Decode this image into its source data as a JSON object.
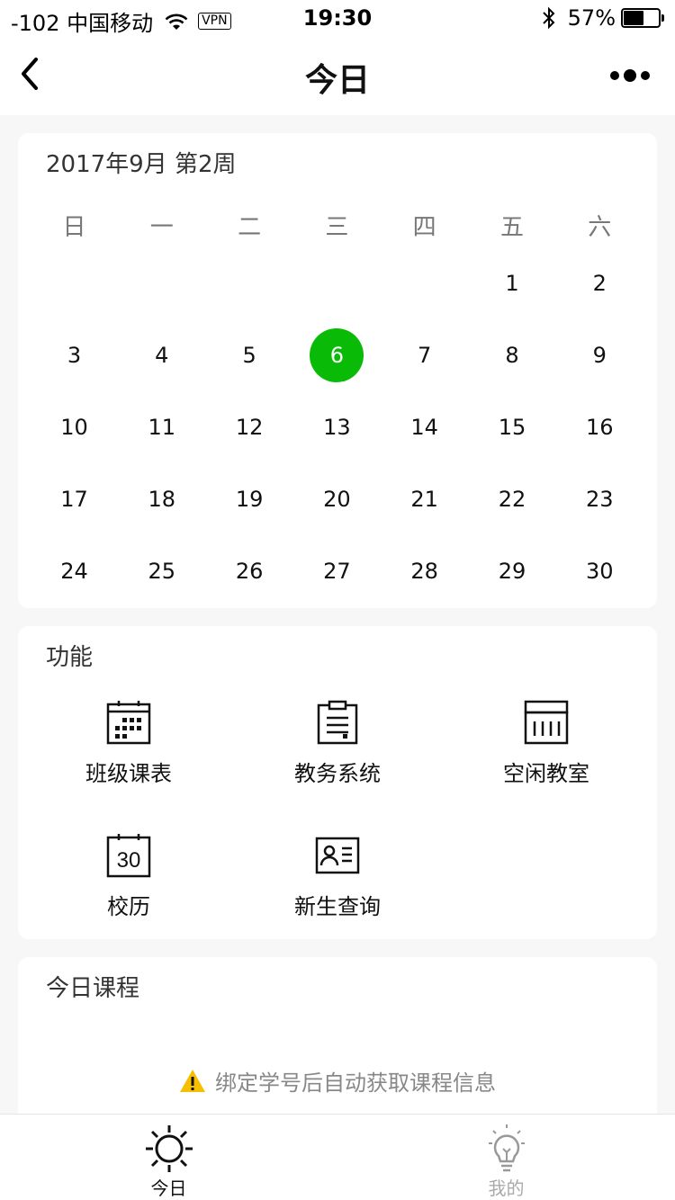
{
  "status_bar": {
    "carrier": "-102 中国移动",
    "vpn": "VPN",
    "time": "19:30",
    "battery_percent": "57%",
    "battery_level": 0.57
  },
  "nav": {
    "title": "今日"
  },
  "calendar": {
    "header": "2017年9月 第2周",
    "weekdays": [
      "日",
      "一",
      "二",
      "三",
      "四",
      "五",
      "六"
    ],
    "first_weekday_index": 5,
    "days": [
      "1",
      "2",
      "3",
      "4",
      "5",
      "6",
      "7",
      "8",
      "9",
      "10",
      "11",
      "12",
      "13",
      "14",
      "15",
      "16",
      "17",
      "18",
      "19",
      "20",
      "21",
      "22",
      "23",
      "24",
      "25",
      "26",
      "27",
      "28",
      "29",
      "30"
    ],
    "selected_day": "6",
    "selected_color": "#09bb07"
  },
  "functions": {
    "title": "功能",
    "items": [
      {
        "label": "班级课表",
        "icon": "calendar-grid-icon"
      },
      {
        "label": "教务系统",
        "icon": "clipboard-icon"
      },
      {
        "label": "空闲教室",
        "icon": "classroom-icon"
      },
      {
        "label": "校历",
        "icon": "calendar-30-icon",
        "icon_text": "30"
      },
      {
        "label": "新生查询",
        "icon": "id-card-icon"
      }
    ]
  },
  "courses": {
    "title": "今日课程",
    "notice": "绑定学号后自动获取课程信息",
    "notice_icon": "warning-icon"
  },
  "tabs": [
    {
      "label": "今日",
      "icon": "sun-icon",
      "active": true
    },
    {
      "label": "我的",
      "icon": "lightbulb-icon",
      "active": false
    }
  ]
}
